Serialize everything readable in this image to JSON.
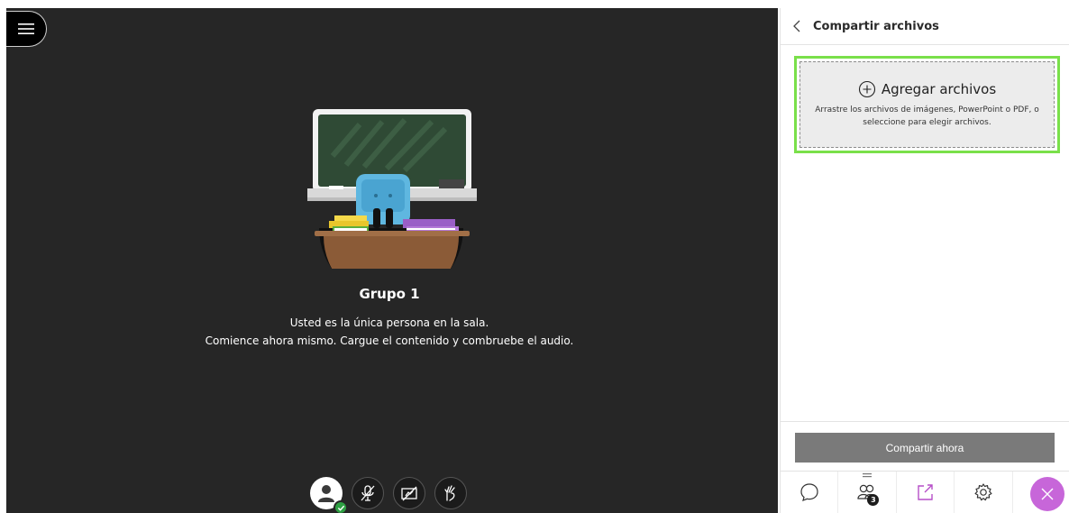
{
  "stage": {
    "room_title": "Grupo 1",
    "message_line1": "Usted es la única persona en la sala.",
    "message_line2": "Comience ahora mismo. Cargue el contenido y combruebe el audio."
  },
  "panel": {
    "title": "Compartir archivos",
    "add_files_label": "Agregar archivos",
    "add_files_help": "Arrastre los archivos de imágenes, PowerPoint o PDF, o seleccione para elegir archivos.",
    "share_now_label": "Compartir ahora"
  },
  "bottom_nav": {
    "attendee_count": "3"
  },
  "icons": {
    "menu": "hamburger-menu-icon",
    "back": "chevron-left-icon",
    "add": "plus-circle-icon",
    "avatar": "user-icon",
    "mic": "mic-off-icon",
    "camera": "camera-off-icon",
    "hand": "raise-hand-icon",
    "chat": "chat-icon",
    "attendees": "attendees-icon",
    "share": "share-content-icon",
    "settings": "gear-icon",
    "close": "close-icon"
  },
  "colors": {
    "stage_bg": "#262626",
    "highlight": "#7ae04a",
    "share_button": "#7a7a7a",
    "share_active": "#b64fc8",
    "close_button": "#c766d9",
    "presence": "#2ea043"
  }
}
